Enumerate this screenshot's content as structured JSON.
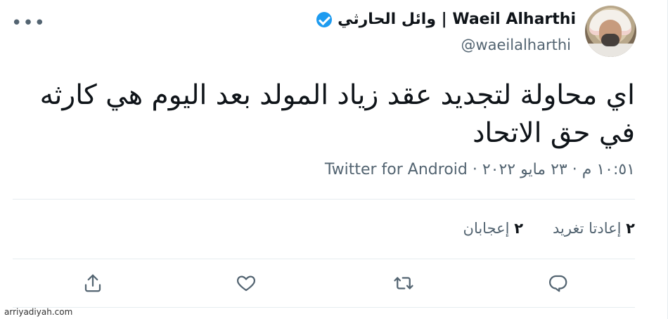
{
  "tweet": {
    "author": {
      "display_name": "وائل الحارثي | Waeil Alharthi",
      "username": "@waeilalharthi",
      "verified": true
    },
    "text": "اي محاولة لتجديد عقد زياد المولد بعد اليوم هي كارثه في حق الاتحاد",
    "timestamp": "١٠:٥١ م · ٢٣ مايو ٢٠٢٢ · Twitter for Android",
    "stats": {
      "retweets_count": "٢",
      "retweets_label": "إعادتا تغريد",
      "likes_count": "٢",
      "likes_label": "إعجابان"
    },
    "menu_icon": "more-horizontal-icon",
    "actions": [
      "reply-icon",
      "retweet-icon",
      "like-icon",
      "share-icon"
    ]
  },
  "watermark": "arriyadiyah.com",
  "colors": {
    "verified_blue": "#1d9bf0",
    "secondary_text": "#536471",
    "primary_text": "#0f1419",
    "divider": "#e6ecf0"
  }
}
